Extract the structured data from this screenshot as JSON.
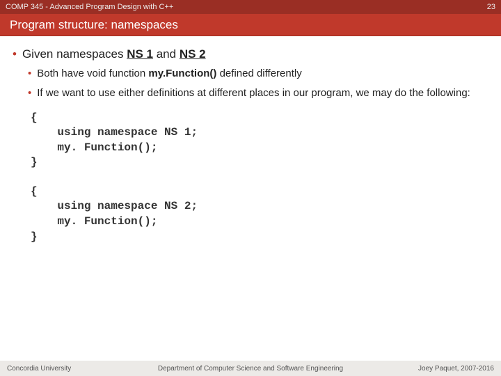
{
  "header": {
    "course": "COMP 345 - Advanced Program Design with C++",
    "pagenum": "23"
  },
  "title": "Program structure: namespaces",
  "b1_prefix": "Given namespaces ",
  "b1_ns1": "NS 1",
  "b1_mid": " and ",
  "b1_ns2": " NS 2",
  "b2_prefix": "Both have void function ",
  "b2_func": "my.Function()",
  "b2_suffix": " defined differently",
  "b3": "If we want to use either definitions at different places in our program, we may do the following:",
  "code1": "{\n    using namespace NS 1;\n    my. Function();\n}",
  "code2": "{\n    using namespace NS 2;\n    my. Function();\n}",
  "footer": {
    "left": "Concordia University",
    "center": "Department of Computer Science and Software Engineering",
    "right": "Joey Paquet, 2007-2016"
  }
}
